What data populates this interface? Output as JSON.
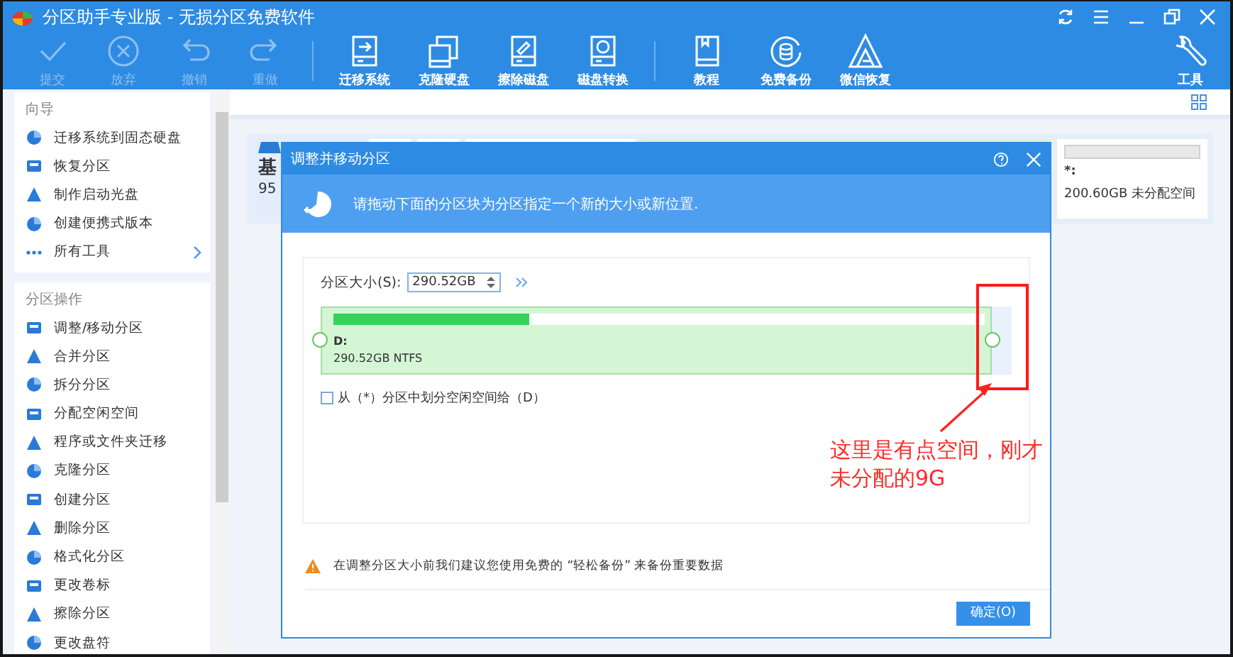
{
  "window": {
    "title": "分区助手专业版 - 无损分区免费软件"
  },
  "toolbar": {
    "buttons": [
      {
        "kind": "check",
        "label": "提交",
        "disabled": true
      },
      {
        "kind": "cancel",
        "label": "放弃",
        "disabled": true
      },
      {
        "kind": "undo",
        "label": "撤销",
        "disabled": true
      },
      {
        "kind": "redo",
        "label": "重做",
        "disabled": true
      },
      {
        "kind": "migrate",
        "label": "迁移系统",
        "disabled": false
      },
      {
        "kind": "clone",
        "label": "克隆硬盘",
        "disabled": false
      },
      {
        "kind": "wipe",
        "label": "擦除磁盘",
        "disabled": false
      },
      {
        "kind": "convert",
        "label": "磁盘转换",
        "disabled": false
      },
      {
        "kind": "book",
        "label": "教程",
        "disabled": false
      },
      {
        "kind": "backup",
        "label": "免费备份",
        "disabled": false
      },
      {
        "kind": "recover",
        "label": "微信恢复",
        "disabled": false
      },
      {
        "kind": "tools",
        "label": "工具",
        "disabled": false
      }
    ]
  },
  "sidebar": {
    "sections": [
      {
        "title": "向导",
        "items": [
          {
            "label": "迁移系统到固态硬盘",
            "kind": "action"
          },
          {
            "label": "恢复分区",
            "kind": "action"
          },
          {
            "label": "制作启动光盘",
            "kind": "action"
          },
          {
            "label": "创建便携式版本",
            "kind": "action"
          },
          {
            "label": "所有工具",
            "kind": "submenu"
          }
        ]
      },
      {
        "title": "分区操作",
        "items": [
          {
            "label": "调整/移动分区",
            "kind": "action"
          },
          {
            "label": "合并分区",
            "kind": "action"
          },
          {
            "label": "拆分分区",
            "kind": "action"
          },
          {
            "label": "分配空闲空间",
            "kind": "action"
          },
          {
            "label": "程序或文件夹迁移",
            "kind": "action"
          },
          {
            "label": "克隆分区",
            "kind": "action"
          },
          {
            "label": "创建分区",
            "kind": "action"
          },
          {
            "label": "删除分区",
            "kind": "action"
          },
          {
            "label": "格式化分区",
            "kind": "action"
          },
          {
            "label": "更改卷标",
            "kind": "action"
          },
          {
            "label": "擦除分区",
            "kind": "action"
          },
          {
            "label": "更改盘符",
            "kind": "action"
          }
        ]
      }
    ]
  },
  "disk_map": {
    "disk": {
      "label": "基",
      "size": "95"
    },
    "unallocated": {
      "drive": "*:",
      "info": "200.60GB 未分配空间"
    }
  },
  "dialog": {
    "title": "调整并移动分区",
    "message": "请拖动下面的分区块为分区指定一个新的大小或新位置.",
    "size_label": "分区大小(S):",
    "size_value": "290.52GB",
    "partition": {
      "drive": "D:",
      "info": "290.52GB NTFS",
      "level": 0.3
    },
    "checkbox": {
      "label": "从（*）分区中划分空闲空间给（D）",
      "checked": false
    },
    "warning": "在调整分区大小前我们建议您使用免费的 “轻松备份” 来备份重要数据",
    "ok_button": "确定(O)"
  },
  "annotation": {
    "text": "这里是有点空间，刚才未分配的9G"
  }
}
